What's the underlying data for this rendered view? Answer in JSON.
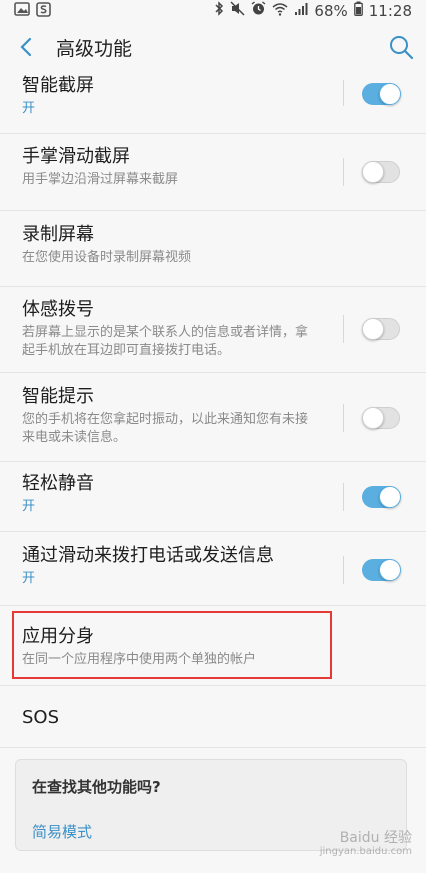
{
  "status_bar": {
    "battery": "68%",
    "time": "11:28"
  },
  "header": {
    "title": "高级功能"
  },
  "items": [
    {
      "title": "智能截屏",
      "subtitle": "开",
      "toggle": "on"
    },
    {
      "title": "手掌滑动截屏",
      "subtitle": "用手掌边沿滑过屏幕来截屏",
      "toggle": "off"
    },
    {
      "title": "录制屏幕",
      "subtitle": "在您使用设备时录制屏幕视频"
    },
    {
      "title": "体感拨号",
      "subtitle": "若屏幕上显示的是某个联系人的信息或者详情，拿起手机放在耳边即可直接拨打电话。",
      "toggle": "off"
    },
    {
      "title": "智能提示",
      "subtitle": "您的手机将在您拿起时振动，以此来通知您有未接来电或未读信息。",
      "toggle": "off"
    },
    {
      "title": "轻松静音",
      "subtitle": "开",
      "toggle": "on"
    },
    {
      "title": "通过滑动来拨打电话或发送信息",
      "subtitle": "开",
      "toggle": "on"
    },
    {
      "title": "应用分身",
      "subtitle": "在同一个应用程序中使用两个单独的帐户"
    },
    {
      "title": "SOS"
    }
  ],
  "card": {
    "title": "在查找其他功能吗?",
    "link": "简易模式"
  },
  "watermark": {
    "line1": "Baidu 经验",
    "line2": "jingyan.baidu.com"
  },
  "colors": {
    "accent": "#3a90c8",
    "toggle_on": "#5aaee0",
    "highlight": "#e53935"
  }
}
